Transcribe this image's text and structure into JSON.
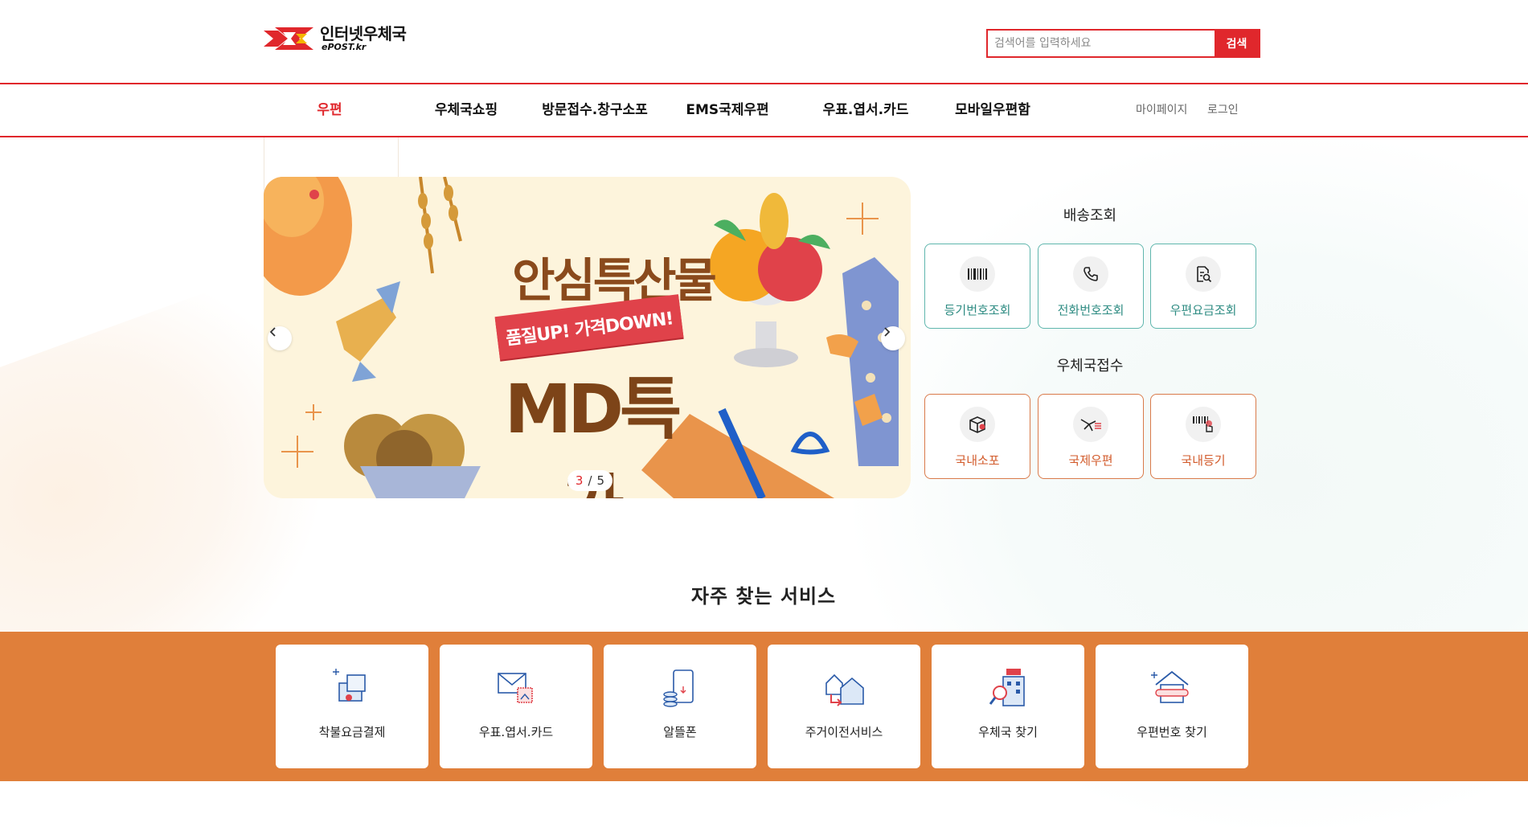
{
  "header": {
    "logo_ko": "인터넷우체국",
    "logo_en": "ePOST.kr",
    "search_placeholder": "검색어를 입력하세요",
    "search_button": "검색"
  },
  "nav": {
    "items": [
      "우편",
      "우체국쇼핑",
      "방문접수.창구소포",
      "EMS국제우편",
      "우표.엽서.카드",
      "모바일우편함"
    ],
    "active": "우편",
    "mypage": "마이페이지",
    "login": "로그인"
  },
  "banner": {
    "title": "안심특산물",
    "subtitle": "품질UP! 가격DOWN!",
    "main": "MD특가",
    "page_current": "3",
    "page_sep": "/",
    "page_total": "5"
  },
  "delivery": {
    "title": "배송조회",
    "items": [
      {
        "label": "등기번호조회",
        "icon": "barcode-icon"
      },
      {
        "label": "전화번호조회",
        "icon": "phone-icon"
      },
      {
        "label": "우편요금조회",
        "icon": "document-search-icon"
      }
    ]
  },
  "post_office": {
    "title": "우체국접수",
    "items": [
      {
        "label": "국내소포",
        "icon": "parcel-box-icon"
      },
      {
        "label": "국제우편",
        "icon": "airplane-icon"
      },
      {
        "label": "국내등기",
        "icon": "barcode-hand-icon"
      }
    ]
  },
  "frequent": {
    "title": "자주 찾는 서비스",
    "items": [
      {
        "label": "착불요금결제",
        "icon": "cod-payment-icon"
      },
      {
        "label": "우표.엽서.카드",
        "icon": "stamp-card-icon"
      },
      {
        "label": "알뜰폰",
        "icon": "mobile-phone-icon"
      },
      {
        "label": "주거이전서비스",
        "icon": "house-move-icon"
      },
      {
        "label": "우체국 찾기",
        "icon": "post-office-search-icon"
      },
      {
        "label": "우편번호 찾기",
        "icon": "zipcode-house-icon"
      }
    ]
  },
  "colors": {
    "brand_red": "#e0272c",
    "teal": "#5fb6ad",
    "orange_border": "#d97a4a",
    "band_orange": "#e07f3a"
  }
}
